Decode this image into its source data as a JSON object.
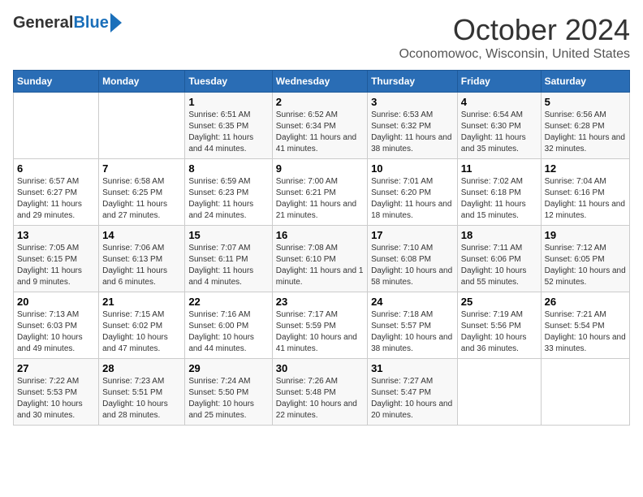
{
  "logo": {
    "general": "General",
    "blue": "Blue"
  },
  "title": {
    "month": "October 2024",
    "location": "Oconomowoc, Wisconsin, United States"
  },
  "headers": [
    "Sunday",
    "Monday",
    "Tuesday",
    "Wednesday",
    "Thursday",
    "Friday",
    "Saturday"
  ],
  "weeks": [
    [
      {
        "day": "",
        "info": ""
      },
      {
        "day": "",
        "info": ""
      },
      {
        "day": "1",
        "info": "Sunrise: 6:51 AM\nSunset: 6:35 PM\nDaylight: 11 hours and 44 minutes."
      },
      {
        "day": "2",
        "info": "Sunrise: 6:52 AM\nSunset: 6:34 PM\nDaylight: 11 hours and 41 minutes."
      },
      {
        "day": "3",
        "info": "Sunrise: 6:53 AM\nSunset: 6:32 PM\nDaylight: 11 hours and 38 minutes."
      },
      {
        "day": "4",
        "info": "Sunrise: 6:54 AM\nSunset: 6:30 PM\nDaylight: 11 hours and 35 minutes."
      },
      {
        "day": "5",
        "info": "Sunrise: 6:56 AM\nSunset: 6:28 PM\nDaylight: 11 hours and 32 minutes."
      }
    ],
    [
      {
        "day": "6",
        "info": "Sunrise: 6:57 AM\nSunset: 6:27 PM\nDaylight: 11 hours and 29 minutes."
      },
      {
        "day": "7",
        "info": "Sunrise: 6:58 AM\nSunset: 6:25 PM\nDaylight: 11 hours and 27 minutes."
      },
      {
        "day": "8",
        "info": "Sunrise: 6:59 AM\nSunset: 6:23 PM\nDaylight: 11 hours and 24 minutes."
      },
      {
        "day": "9",
        "info": "Sunrise: 7:00 AM\nSunset: 6:21 PM\nDaylight: 11 hours and 21 minutes."
      },
      {
        "day": "10",
        "info": "Sunrise: 7:01 AM\nSunset: 6:20 PM\nDaylight: 11 hours and 18 minutes."
      },
      {
        "day": "11",
        "info": "Sunrise: 7:02 AM\nSunset: 6:18 PM\nDaylight: 11 hours and 15 minutes."
      },
      {
        "day": "12",
        "info": "Sunrise: 7:04 AM\nSunset: 6:16 PM\nDaylight: 11 hours and 12 minutes."
      }
    ],
    [
      {
        "day": "13",
        "info": "Sunrise: 7:05 AM\nSunset: 6:15 PM\nDaylight: 11 hours and 9 minutes."
      },
      {
        "day": "14",
        "info": "Sunrise: 7:06 AM\nSunset: 6:13 PM\nDaylight: 11 hours and 6 minutes."
      },
      {
        "day": "15",
        "info": "Sunrise: 7:07 AM\nSunset: 6:11 PM\nDaylight: 11 hours and 4 minutes."
      },
      {
        "day": "16",
        "info": "Sunrise: 7:08 AM\nSunset: 6:10 PM\nDaylight: 11 hours and 1 minute."
      },
      {
        "day": "17",
        "info": "Sunrise: 7:10 AM\nSunset: 6:08 PM\nDaylight: 10 hours and 58 minutes."
      },
      {
        "day": "18",
        "info": "Sunrise: 7:11 AM\nSunset: 6:06 PM\nDaylight: 10 hours and 55 minutes."
      },
      {
        "day": "19",
        "info": "Sunrise: 7:12 AM\nSunset: 6:05 PM\nDaylight: 10 hours and 52 minutes."
      }
    ],
    [
      {
        "day": "20",
        "info": "Sunrise: 7:13 AM\nSunset: 6:03 PM\nDaylight: 10 hours and 49 minutes."
      },
      {
        "day": "21",
        "info": "Sunrise: 7:15 AM\nSunset: 6:02 PM\nDaylight: 10 hours and 47 minutes."
      },
      {
        "day": "22",
        "info": "Sunrise: 7:16 AM\nSunset: 6:00 PM\nDaylight: 10 hours and 44 minutes."
      },
      {
        "day": "23",
        "info": "Sunrise: 7:17 AM\nSunset: 5:59 PM\nDaylight: 10 hours and 41 minutes."
      },
      {
        "day": "24",
        "info": "Sunrise: 7:18 AM\nSunset: 5:57 PM\nDaylight: 10 hours and 38 minutes."
      },
      {
        "day": "25",
        "info": "Sunrise: 7:19 AM\nSunset: 5:56 PM\nDaylight: 10 hours and 36 minutes."
      },
      {
        "day": "26",
        "info": "Sunrise: 7:21 AM\nSunset: 5:54 PM\nDaylight: 10 hours and 33 minutes."
      }
    ],
    [
      {
        "day": "27",
        "info": "Sunrise: 7:22 AM\nSunset: 5:53 PM\nDaylight: 10 hours and 30 minutes."
      },
      {
        "day": "28",
        "info": "Sunrise: 7:23 AM\nSunset: 5:51 PM\nDaylight: 10 hours and 28 minutes."
      },
      {
        "day": "29",
        "info": "Sunrise: 7:24 AM\nSunset: 5:50 PM\nDaylight: 10 hours and 25 minutes."
      },
      {
        "day": "30",
        "info": "Sunrise: 7:26 AM\nSunset: 5:48 PM\nDaylight: 10 hours and 22 minutes."
      },
      {
        "day": "31",
        "info": "Sunrise: 7:27 AM\nSunset: 5:47 PM\nDaylight: 10 hours and 20 minutes."
      },
      {
        "day": "",
        "info": ""
      },
      {
        "day": "",
        "info": ""
      }
    ]
  ]
}
